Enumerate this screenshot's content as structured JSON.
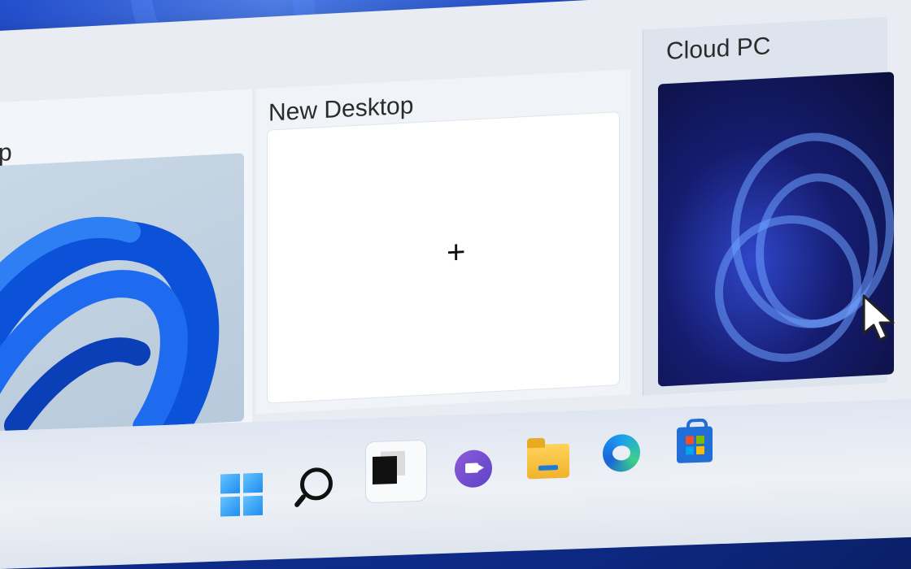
{
  "desktops": [
    {
      "title": "ktop",
      "type": "desktop",
      "active": true
    },
    {
      "title": "New Desktop",
      "type": "new-desktop",
      "add_symbol": "+"
    },
    {
      "title": "Cloud PC",
      "type": "cloud-pc"
    }
  ],
  "taskbar": {
    "items": [
      {
        "icon": "windows-start-icon"
      },
      {
        "icon": "search-icon"
      },
      {
        "icon": "task-view-icon",
        "active": true
      },
      {
        "icon": "chat-icon"
      },
      {
        "icon": "file-explorer-icon"
      },
      {
        "icon": "edge-browser-icon"
      },
      {
        "icon": "store-icon"
      }
    ]
  },
  "colors": {
    "accent": "#1f56c6",
    "panel": "#e9edf3",
    "wallpaper": "#1c46c8"
  }
}
